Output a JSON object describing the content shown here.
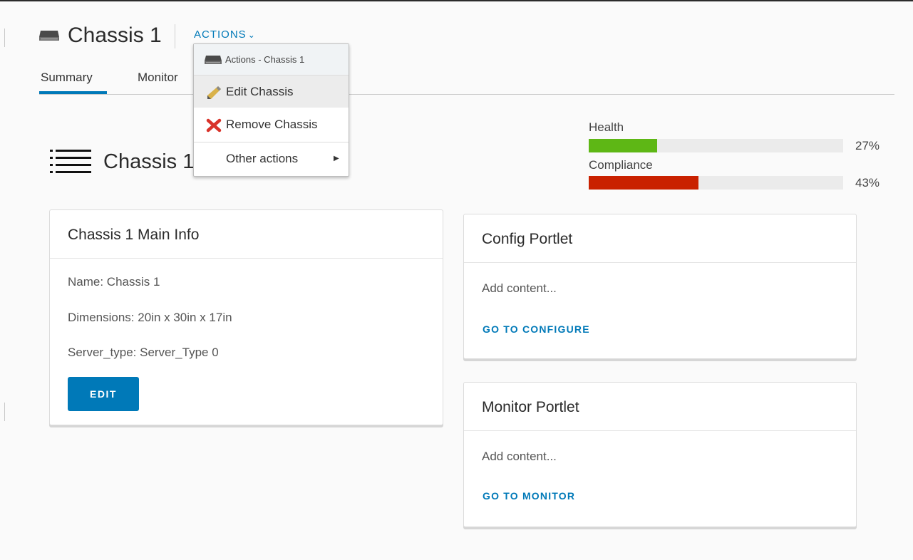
{
  "header": {
    "title": "Chassis 1",
    "actions_label": "ACTIONS",
    "chevron_glyph": "⌄"
  },
  "tabs": [
    {
      "label": "Summary",
      "active": true
    },
    {
      "label": "Monitor",
      "active": false
    }
  ],
  "object": {
    "title": "Chassis 1"
  },
  "metrics": [
    {
      "label": "Health",
      "percent": 27,
      "percent_label": "27%",
      "color": "#5eb715"
    },
    {
      "label": "Compliance",
      "percent": 43,
      "percent_label": "43%",
      "color": "#c92100"
    }
  ],
  "main_info": {
    "title": "Chassis 1 Main Info",
    "name": "Name: Chassis 1",
    "dimensions": "Dimensions: 20in x 30in x 17in",
    "server_type": "Server_type: Server_Type 0",
    "edit_label": "EDIT"
  },
  "config_portlet": {
    "title": "Config Portlet",
    "content": "Add content...",
    "link": "GO TO CONFIGURE"
  },
  "monitor_portlet": {
    "title": "Monitor Portlet",
    "content": "Add content...",
    "link": "GO TO MONITOR"
  },
  "actions_menu": {
    "header": "Actions - Chassis 1",
    "items": [
      {
        "label": "Edit Chassis",
        "icon": "pencil-icon"
      },
      {
        "label": "Remove Chassis",
        "icon": "red-x-icon"
      },
      {
        "label": "Other actions",
        "icon": "submenu-arrow-icon"
      }
    ],
    "submenu_arrow": "▶"
  },
  "colors": {
    "accent": "#0079b8",
    "health": "#5eb715",
    "compliance": "#c92100"
  }
}
